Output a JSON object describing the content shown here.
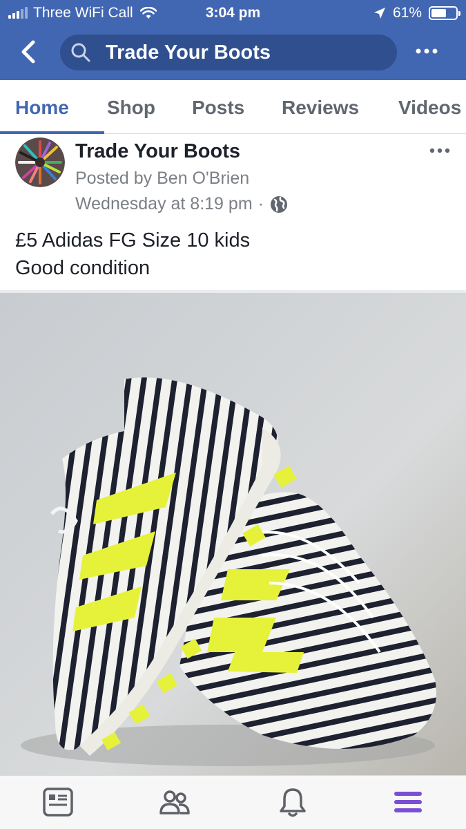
{
  "status_bar": {
    "carrier": "Three WiFi Call",
    "time": "3:04 pm",
    "battery": "61%",
    "battery_level": 0.61,
    "icons": [
      "signal-icon",
      "wifi-icon",
      "location-arrow-icon",
      "battery-icon"
    ]
  },
  "header": {
    "search_text": "Trade Your Boots",
    "icons": [
      "back-chevron-icon",
      "search-icon",
      "more-icon"
    ]
  },
  "tabs": [
    {
      "label": "Home",
      "active": true
    },
    {
      "label": "Shop",
      "active": false
    },
    {
      "label": "Posts",
      "active": false
    },
    {
      "label": "Reviews",
      "active": false
    },
    {
      "label": "Videos",
      "active": false
    }
  ],
  "post": {
    "page_name": "Trade Your Boots",
    "posted_by": "Posted by Ben O'Brien",
    "timestamp": "Wednesday at 8:19 pm",
    "separator": "·",
    "privacy_icon": "globe-icon",
    "text_lines": [
      "£5 Adidas FG Size 10 kids",
      "Good condition"
    ],
    "photo": "football-boots-photo"
  },
  "bottom_nav": {
    "icons": [
      "news-feed-icon",
      "friends-icon",
      "notifications-bell-icon",
      "menu-icon"
    ],
    "accent": "#4267b2",
    "active_color": "#7b4fd4"
  },
  "colors": {
    "header_blue": "#4267b2",
    "search_bg": "#2f4f8f",
    "tab_active": "#4267b2",
    "text_gray": "#7b7f86"
  }
}
